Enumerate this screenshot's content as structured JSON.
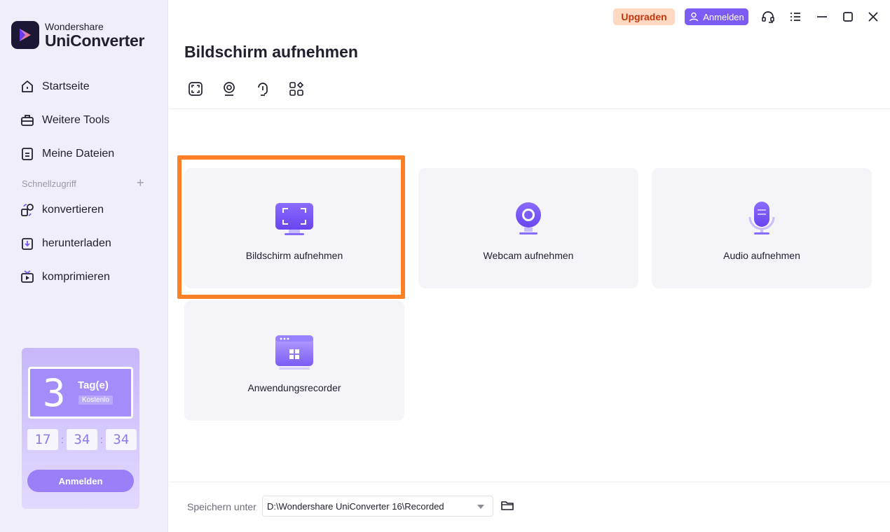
{
  "brand": {
    "company": "Wondershare",
    "product": "UniConverter"
  },
  "sidebar": {
    "items": [
      {
        "label": "Startseite",
        "icon": "home-icon"
      },
      {
        "label": "Weitere Tools",
        "icon": "toolbox-icon"
      },
      {
        "label": "Meine Dateien",
        "icon": "files-icon"
      }
    ],
    "quick_access_label": "Schnellzugriff",
    "quick_items": [
      {
        "label": "konvertieren",
        "icon": "convert-icon"
      },
      {
        "label": "herunterladen",
        "icon": "download-icon"
      },
      {
        "label": "komprimieren",
        "icon": "compress-icon"
      }
    ]
  },
  "promo": {
    "days": "3",
    "unit": "Tag(e)",
    "free": "Kostenlo",
    "timer": [
      "17",
      "34",
      "34"
    ],
    "button": "Anmelden"
  },
  "header": {
    "upgrade": "Upgraden",
    "login": "Anmelden"
  },
  "main": {
    "title": "Bildschirm aufnehmen",
    "cards": [
      {
        "label": "Bildschirm aufnehmen",
        "icon": "screen-record-icon"
      },
      {
        "label": "Webcam aufnehmen",
        "icon": "webcam-icon"
      },
      {
        "label": "Audio aufnehmen",
        "icon": "microphone-icon"
      },
      {
        "label": "Anwendungsrecorder",
        "icon": "app-recorder-icon"
      }
    ]
  },
  "footer": {
    "save_label": "Speichern unter",
    "path": "D:\\Wondershare UniConverter 16\\Recorded"
  },
  "colors": {
    "accent": "#7c5cf5",
    "highlight": "#ff7f27",
    "upgrade_bg": "#ffd8c2",
    "upgrade_text": "#c2360b"
  }
}
